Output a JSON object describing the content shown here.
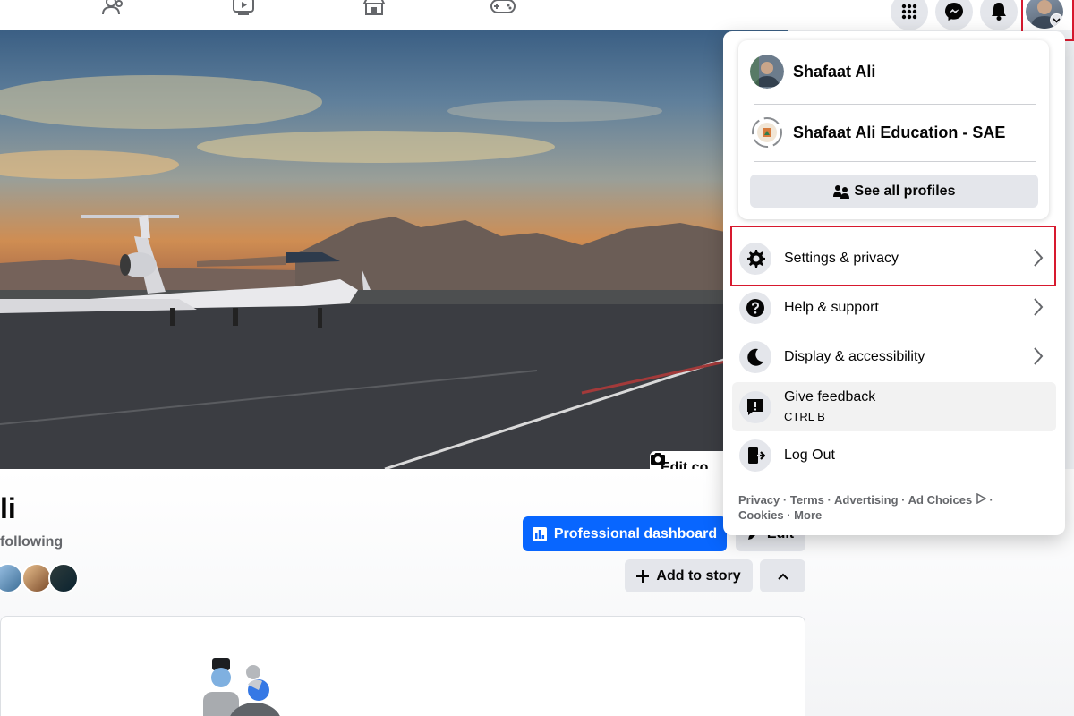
{
  "cover": {
    "edit_cover_label": "Edit co"
  },
  "profile": {
    "name_fragment": "li",
    "following_fragment": "following",
    "professional_dashboard_label": "Professional dashboard",
    "edit_label": "Edit",
    "add_to_story_label": "Add to story"
  },
  "menu": {
    "profiles": [
      {
        "name": "Shafaat Ali"
      },
      {
        "name": "Shafaat Ali Education - SAE"
      }
    ],
    "see_all_profiles_label": "See all profiles",
    "items": [
      {
        "label": "Settings & privacy",
        "icon": "gear-icon"
      },
      {
        "label": "Help & support",
        "icon": "question-icon"
      },
      {
        "label": "Display & accessibility",
        "icon": "moon-icon"
      },
      {
        "label": "Give feedback",
        "sub": "CTRL B",
        "icon": "feedback-icon"
      },
      {
        "label": "Log Out",
        "icon": "logout-icon"
      }
    ],
    "footer": {
      "privacy": "Privacy",
      "terms": "Terms",
      "advertising": "Advertising",
      "ad_choices": "Ad Choices",
      "cookies": "Cookies",
      "more": "More",
      "separator": "·"
    }
  },
  "colors": {
    "brand_blue": "#0866ff",
    "highlight_red": "#d7192e",
    "button_grey": "#e4e6eb"
  }
}
